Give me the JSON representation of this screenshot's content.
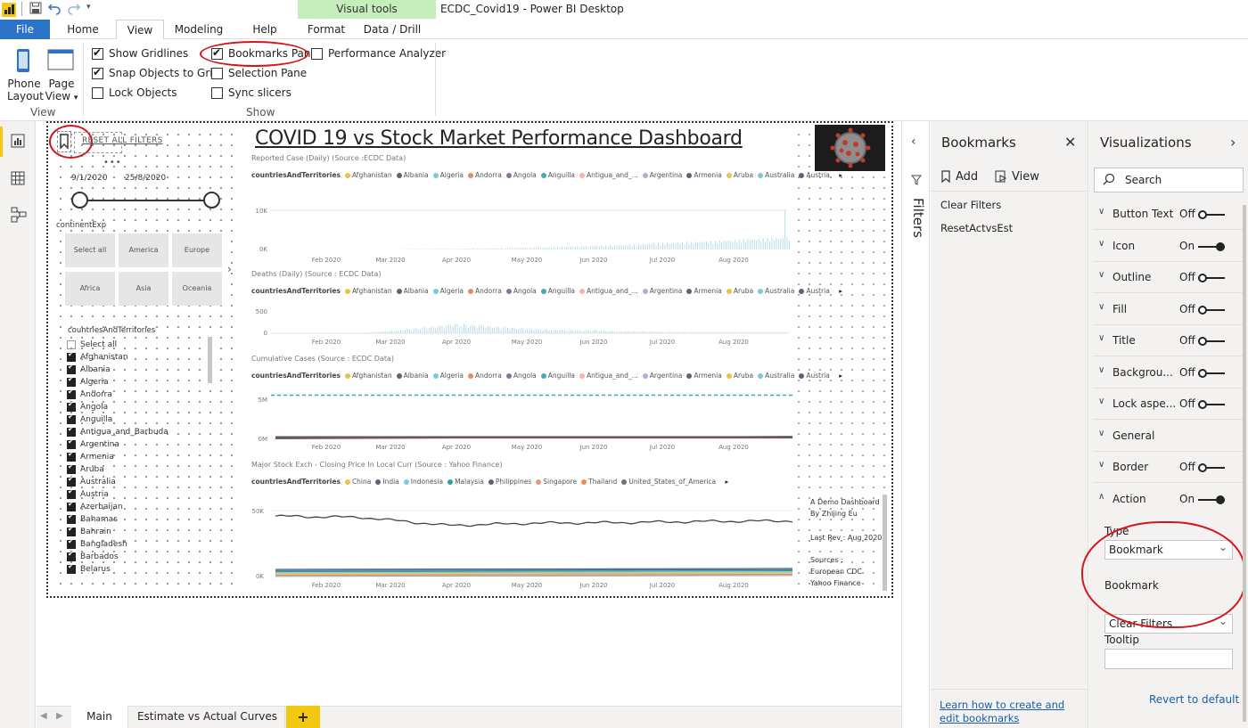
{
  "window": {
    "title": "ECDC_Covid19 - Power BI Desktop",
    "context_band": "Visual tools"
  },
  "tabs": {
    "file": "File",
    "home": "Home",
    "view": "View",
    "modeling": "Modeling",
    "help": "Help",
    "format": "Format",
    "data_drill": "Data / Drill"
  },
  "ribbon": {
    "phone_layout_1": "Phone",
    "phone_layout_2": "Layout",
    "page_view_1": "Page",
    "page_view_2": "View",
    "view_group": "View",
    "show_group": "Show",
    "show_gridlines": "Show Gridlines",
    "snap_to_grid": "Snap Objects to Grid",
    "lock_objects": "Lock Objects",
    "bookmarks_pane": "Bookmarks Pane",
    "selection_pane": "Selection Pane",
    "sync_slicers": "Sync slicers",
    "performance_analyzer": "Performance Analyzer"
  },
  "report": {
    "title": "COVID 19 vs Stock Market Performance Dashboard",
    "reset_button": "RESET ALL FILTERS",
    "date_start": "9/1/2020",
    "date_end": "25/8/2020",
    "continent_label": "continentExp",
    "continents": [
      "Select all",
      "America",
      "Europe",
      "Africa",
      "Asia",
      "Oceania"
    ],
    "countries_label": "countriesAndTerritories",
    "select_all": "Select all",
    "countries": [
      "Afghanistan",
      "Albania",
      "Algeria",
      "Andorra",
      "Angola",
      "Anguilla",
      "Antigua_and_Barbuda",
      "Argentina",
      "Armenia",
      "Aruba",
      "Australia",
      "Austria",
      "Azerbaijan",
      "Bahamas",
      "Bahrain",
      "Bangladesh",
      "Barbados",
      "Belarus"
    ],
    "legend_field": "countriesAndTerritories",
    "legend_countries": [
      "Afghanistan",
      "Albania",
      "Algeria",
      "Andorra",
      "Angola",
      "Anguilla",
      "Antigua_and_...",
      "Argentina",
      "Armenia",
      "Aruba",
      "Australia",
      "Austria"
    ],
    "legend_colors": [
      "#e8c34a",
      "#5a6474",
      "#7fc6e4",
      "#f08a5d",
      "#8e6fa3",
      "#4aa7b5",
      "#f0b4b4",
      "#a7b1e4",
      "#5a6474",
      "#e8c34a",
      "#7fc6e4",
      "#5a6474"
    ],
    "stock_legend": [
      "China",
      "India",
      "Indonesia",
      "Malaysia",
      "Philippines",
      "Singapore",
      "Thailand",
      "United_States_of_America"
    ],
    "stock_colors": [
      "#e8c34a",
      "#5a6474",
      "#7fc6e4",
      "#2ea39a",
      "#5a6474",
      "#e89a7f",
      "#f08a5d",
      "#6b7480"
    ],
    "note_1": "A Demo Dashboard",
    "note_2": "By Zhijing Eu",
    "note_3": "Last Rev : Aug 2020",
    "sources_1": "Sources :",
    "sources_2": "European CDC",
    "sources_3": "Yahoo Finance",
    "months": [
      "Feb 2020",
      "Mar 2020",
      "Apr 2020",
      "May 2020",
      "Jun 2020",
      "Jul 2020",
      "Aug 2020"
    ]
  },
  "chart_data": [
    {
      "type": "bar",
      "title": "Reported Case (Daily) (Source :ECDC Data)",
      "categories": [
        "Feb 2020",
        "Mar 2020",
        "Apr 2020",
        "May 2020",
        "Jun 2020",
        "Jul 2020",
        "Aug 2020"
      ],
      "yticks": [
        "10K",
        "0K"
      ],
      "ylim": [
        0,
        14000
      ],
      "series": [
        {
          "values": [
            0,
            0,
            150,
            400,
            900,
            1600,
            2400
          ]
        }
      ]
    },
    {
      "type": "bar",
      "title": "Deaths (Daily) (Source : ECDC Data)",
      "categories": [
        "Feb 2020",
        "Mar 2020",
        "Apr 2020",
        "May 2020",
        "Jun 2020",
        "Jul 2020",
        "Aug 2020"
      ],
      "yticks": [
        "500",
        "0"
      ],
      "ylim": [
        0,
        600
      ],
      "series": [
        {
          "values": [
            0,
            15,
            180,
            80,
            40,
            20,
            20
          ]
        }
      ]
    },
    {
      "type": "line",
      "title": "Cumulative Cases (Source : ECDC Data)",
      "categories": [
        "Feb 2020",
        "Mar 2020",
        "Apr 2020",
        "May 2020",
        "Jun 2020",
        "Jul 2020",
        "Aug 2020"
      ],
      "yticks": [
        "5M",
        "0M"
      ],
      "ylim": [
        0,
        6000000
      ],
      "reference_line": 5600000
    },
    {
      "type": "line",
      "title": "Major Stock Exch - Closing Price In Local Curr (Source : Yahoo Finance)",
      "categories": [
        "Feb 2020",
        "Mar 2020",
        "Apr 2020",
        "May 2020",
        "Jun 2020",
        "Jul 2020",
        "Aug 2020"
      ],
      "yticks": [
        "50K",
        "0K"
      ],
      "ylim": [
        0,
        60000
      ],
      "series": [
        {
          "name": "China",
          "values": [
            49000,
            48000,
            41000,
            43000,
            43500,
            44500,
            45000
          ]
        },
        {
          "name": "India",
          "values": [
            3000,
            2800,
            2500,
            2600,
            2700,
            2800,
            2900
          ]
        }
      ]
    }
  ],
  "bottom_tabs": {
    "main": "Main",
    "estimate": "Estimate vs Actual Curves",
    "add": "+"
  },
  "filters": {
    "label": "Filters"
  },
  "bookmarks": {
    "title": "Bookmarks",
    "add": "Add",
    "view": "View",
    "items": [
      "Clear Filters",
      "ResetActvsEst"
    ],
    "learn_link": "Learn how to create and edit bookmarks"
  },
  "visualizations": {
    "title": "Visualizations",
    "search_placeholder": "Search",
    "props": [
      {
        "name": "Button Text",
        "state": "Off"
      },
      {
        "name": "Icon",
        "state": "On"
      },
      {
        "name": "Outline",
        "state": "Off"
      },
      {
        "name": "Fill",
        "state": "Off"
      },
      {
        "name": "Title",
        "state": "Off"
      },
      {
        "name": "Backgrou...",
        "state": "Off"
      },
      {
        "name": "Lock aspe...",
        "state": "Off"
      },
      {
        "name": "General",
        "state": ""
      },
      {
        "name": "Border",
        "state": "Off"
      },
      {
        "name": "Action",
        "state": "On"
      }
    ],
    "type_label": "Type",
    "type_value": "Bookmark",
    "bookmark_label": "Bookmark",
    "bookmark_value": "Clear Filters",
    "tooltip_label": "Tooltip",
    "revert": "Revert to default"
  },
  "colors": {
    "accent_yellow": "#f2c811",
    "file_blue": "#2b73c6",
    "annotation_red": "#d4151b",
    "context_green": "#c6eebc"
  }
}
